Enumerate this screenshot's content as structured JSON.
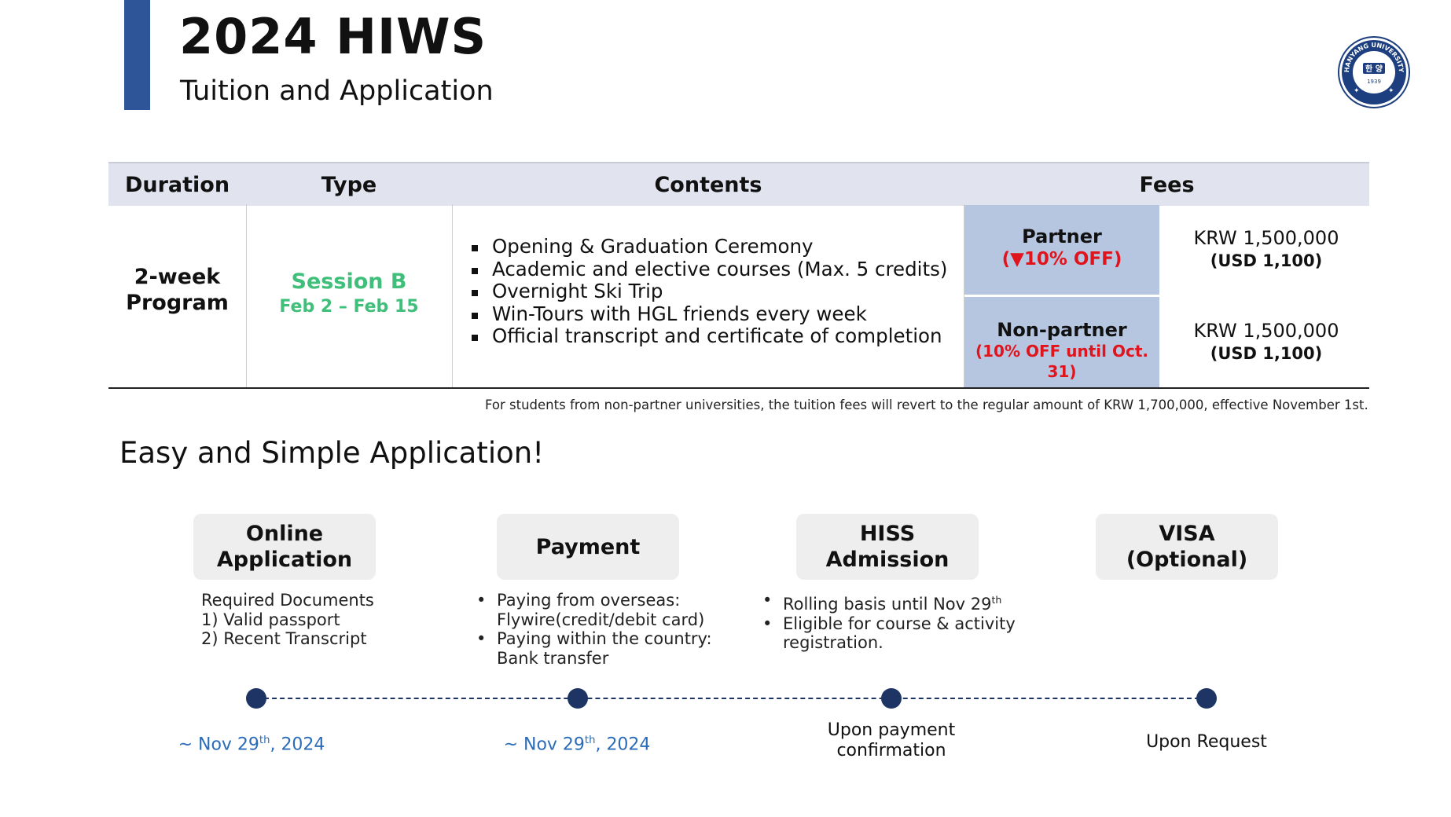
{
  "header": {
    "title": "2024 HIWS",
    "subtitle": "Tuition and Application",
    "accent_color": "#2d5597",
    "seal": {
      "arc_text": "HANYANG UNIVERSITY",
      "center_text": "한 양",
      "year": "1939"
    }
  },
  "table": {
    "columns": [
      "Duration",
      "Type",
      "Contents",
      "Fees"
    ],
    "duration_line1": "2-week",
    "duration_line2": "Program",
    "type_session": "Session B",
    "type_dates": "Feb 2 – Feb 15",
    "type_color": "#3fbf7a",
    "contents": [
      "Opening & Graduation Ceremony",
      "Academic and elective courses (Max. 5 credits)",
      "Overnight Ski Trip",
      "Win-Tours with HGL friends every week",
      "Official transcript and certificate of completion"
    ],
    "fees": {
      "partner": {
        "label": "Partner",
        "discount": "(▼10% OFF)",
        "krw": "KRW 1,500,000",
        "usd": "(USD 1,100)"
      },
      "nonpartner": {
        "label": "Non-partner",
        "discount": "(10% OFF until Oct. 31)",
        "krw": "KRW 1,500,000",
        "usd": "(USD 1,100)"
      },
      "label_bg": "#b7c6e0",
      "discount_color": "#e0141c"
    },
    "note": "For students from non-partner universities, the tuition fees will revert to the regular amount of KRW 1,700,000, effective November 1st."
  },
  "application": {
    "title": "Easy and Simple Application!",
    "steps": [
      {
        "line1": "Online",
        "line2": "Application",
        "desc_heading": "Required Documents",
        "desc_items": [
          "1)   Valid passport",
          "2)  Recent Transcript"
        ],
        "date_pre": "~ Nov 29",
        "date_sup": "th",
        "date_post": ", 2024"
      },
      {
        "line1": "Payment",
        "bullets": [
          {
            "a": "Paying from overseas:",
            "b": "Flywire(credit/debit card)"
          },
          {
            "a": "Paying within the country:",
            "b": "Bank transfer"
          }
        ],
        "date_pre": "~ Nov 29",
        "date_sup": "th",
        "date_post": ", 2024"
      },
      {
        "line1": "HISS",
        "line2": "Admission",
        "bullet1_pre": "Rolling basis until Nov 29",
        "bullet1_sup": "th",
        "bullet2_a": "Eligible for course & activity",
        "bullet2_b": "registration.",
        "date_line1": "Upon payment",
        "date_line2": "confirmation"
      },
      {
        "line1": "VISA",
        "line2": "(Optional)",
        "date": "Upon Request"
      }
    ],
    "timeline_color": "#1e3464",
    "date_color": "#2b6cb8"
  }
}
